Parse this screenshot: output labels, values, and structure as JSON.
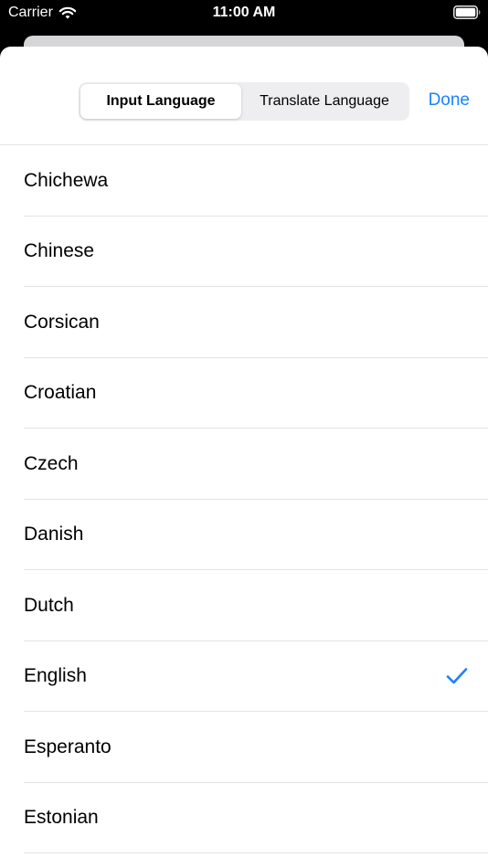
{
  "status_bar": {
    "carrier": "Carrier",
    "time": "11:00 AM",
    "icons": [
      "wifi-icon",
      "battery-icon"
    ]
  },
  "toolbar": {
    "segments": [
      {
        "label": "Input Language",
        "selected": true
      },
      {
        "label": "Translate Language",
        "selected": false
      }
    ],
    "done_label": "Done"
  },
  "languages": [
    {
      "name": "Chichewa",
      "selected": false
    },
    {
      "name": "Chinese",
      "selected": false
    },
    {
      "name": "Corsican",
      "selected": false
    },
    {
      "name": "Croatian",
      "selected": false
    },
    {
      "name": "Czech",
      "selected": false
    },
    {
      "name": "Danish",
      "selected": false
    },
    {
      "name": "Dutch",
      "selected": false
    },
    {
      "name": "English",
      "selected": true
    },
    {
      "name": "Esperanto",
      "selected": false
    },
    {
      "name": "Estonian",
      "selected": false
    }
  ],
  "colors": {
    "accent": "#1a82fb",
    "separator": "#e3e3e5",
    "background": "#000000",
    "sheet": "#ffffff"
  }
}
